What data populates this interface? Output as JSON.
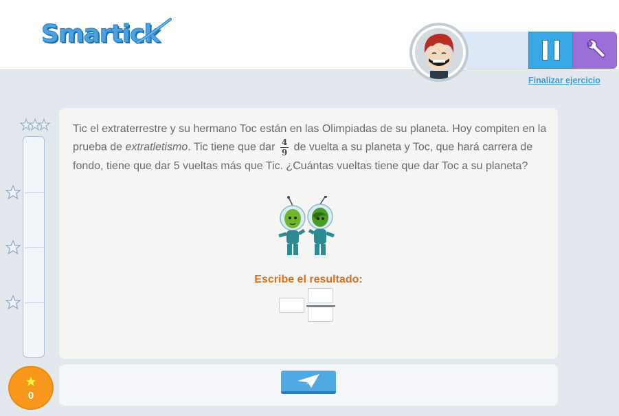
{
  "app": {
    "logo_text": "Smartick"
  },
  "header": {
    "finish_link": "Finalizar ejercicio",
    "pause_icon": "pause-icon",
    "settings_icon": "wrench-icon"
  },
  "sidebar": {
    "score": "0",
    "milestone_icon": "star-outline-icon"
  },
  "question": {
    "text_part1": "Tic el extraterrestre y su hermano Toc están en las Olimpiadas de su planeta. Hoy compiten en la prueba de ",
    "text_italic": "extratletismo",
    "text_part2": ". Tic tiene que dar ",
    "fraction_num": "4",
    "fraction_den": "9",
    "text_part3": " de vuelta a su planeta y Toc, que hará carrera de fondo, tiene que dar 5 vueltas más que Tic. ¿Cuántas vueltas tiene que dar Toc a su planeta?",
    "answer_label": "Escribe el resultado:",
    "whole_value": "",
    "numerator_value": "",
    "denominator_value": ""
  },
  "submit": {
    "icon": "paper-plane-icon"
  },
  "colors": {
    "accent_blue": "#38a9e6",
    "accent_purple": "#9b6fd8",
    "answer_orange": "#d9711f",
    "score_orange": "#f7981d"
  }
}
